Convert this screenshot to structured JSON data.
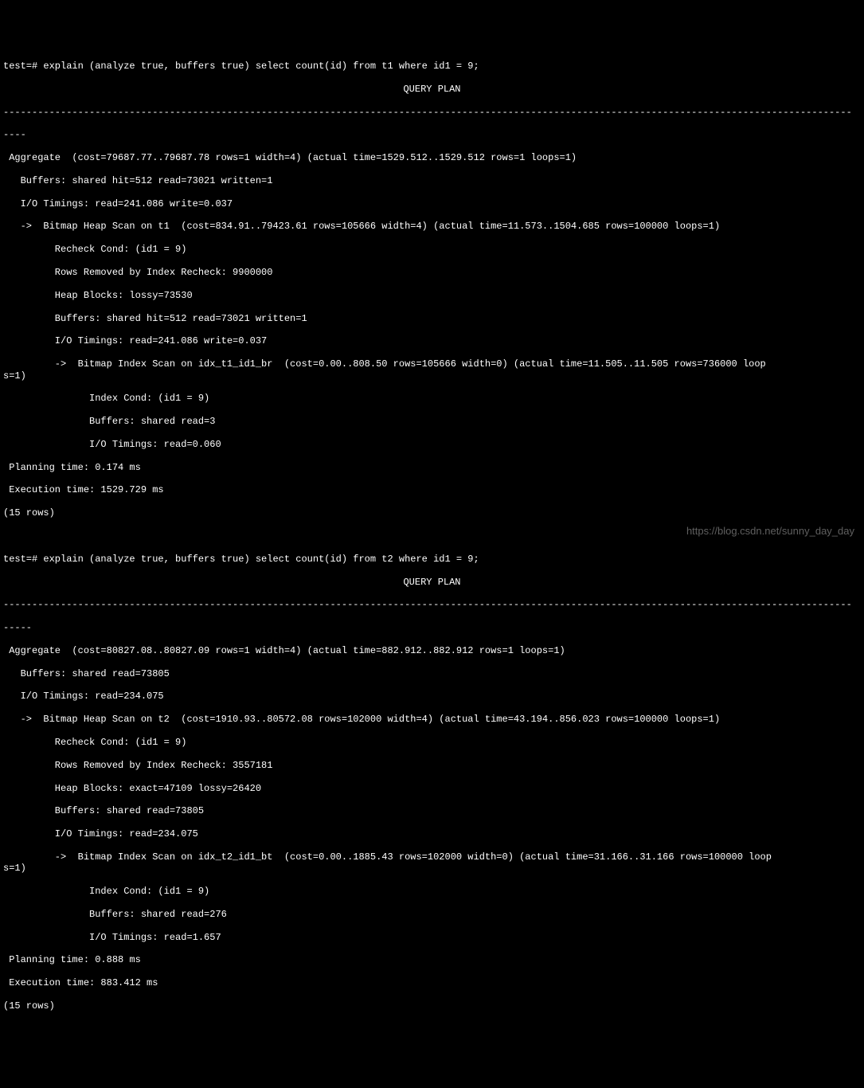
{
  "query1": {
    "command": "test=# explain (analyze true, buffers true) select count(id) from t1 where id1 = 9;",
    "header": "QUERY PLAN",
    "separator": "----------------------------------------------------------------------------------------------------------------------------------------------------",
    "lines": [
      " Aggregate  (cost=79687.77..79687.78 rows=1 width=4) (actual time=1529.512..1529.512 rows=1 loops=1)",
      "   Buffers: shared hit=512 read=73021 written=1",
      "   I/O Timings: read=241.086 write=0.037",
      "   ->  Bitmap Heap Scan on t1  (cost=834.91..79423.61 rows=105666 width=4) (actual time=11.573..1504.685 rows=100000 loops=1)",
      "         Recheck Cond: (id1 = 9)",
      "         Rows Removed by Index Recheck: 9900000",
      "         Heap Blocks: lossy=73530",
      "         Buffers: shared hit=512 read=73021 written=1",
      "         I/O Timings: read=241.086 write=0.037",
      "         ->  Bitmap Index Scan on idx_t1_id1_br  (cost=0.00..808.50 rows=105666 width=0) (actual time=11.505..11.505 rows=736000 loops=1)",
      "               Index Cond: (id1 = 9)",
      "               Buffers: shared read=3",
      "               I/O Timings: read=0.060",
      " Planning time: 0.174 ms",
      " Execution time: 1529.729 ms",
      "(15 rows)"
    ]
  },
  "query2": {
    "command": "test=# explain (analyze true, buffers true) select count(id) from t2 where id1 = 9;",
    "header": "QUERY PLAN",
    "separator": "----------------------------------------------------------------------------------------------------------------------------------------------------",
    "lines": [
      " Aggregate  (cost=80827.08..80827.09 rows=1 width=4) (actual time=882.912..882.912 rows=1 loops=1)",
      "   Buffers: shared read=73805",
      "   I/O Timings: read=234.075",
      "   ->  Bitmap Heap Scan on t2  (cost=1910.93..80572.08 rows=102000 width=4) (actual time=43.194..856.023 rows=100000 loops=1)",
      "         Recheck Cond: (id1 = 9)",
      "         Rows Removed by Index Recheck: 3557181",
      "         Heap Blocks: exact=47109 lossy=26420",
      "         Buffers: shared read=73805",
      "         I/O Timings: read=234.075",
      "         ->  Bitmap Index Scan on idx_t2_id1_bt  (cost=0.00..1885.43 rows=102000 width=0) (actual time=31.166..31.166 rows=100000 loops=1)",
      "               Index Cond: (id1 = 9)",
      "               Buffers: shared read=276",
      "               I/O Timings: read=1.657",
      " Planning time: 0.888 ms",
      " Execution time: 883.412 ms",
      "(15 rows)"
    ]
  },
  "watermark": "https://blog.csdn.net/sunny_day_day"
}
